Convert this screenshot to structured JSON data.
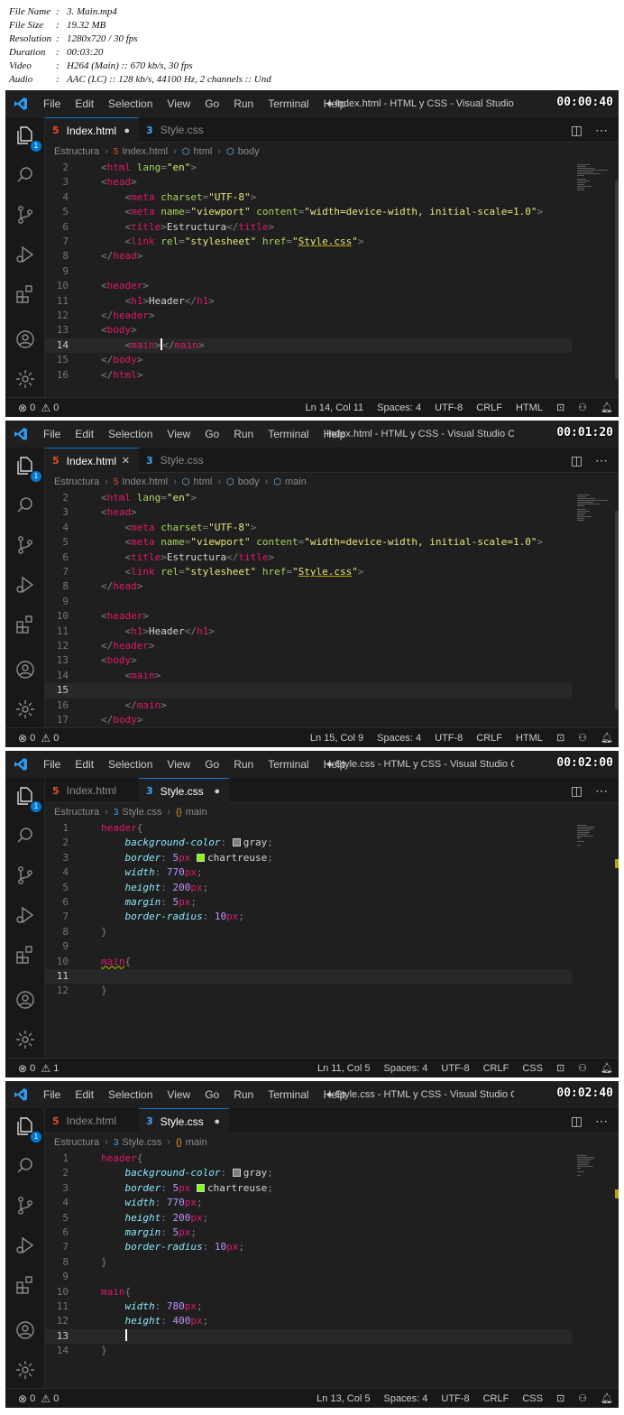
{
  "file_info": [
    {
      "key": "File Name",
      "value": "3. Main.mp4"
    },
    {
      "key": "File Size",
      "value": "19.32 MB"
    },
    {
      "key": "Resolution",
      "value": "1280x720 / 30 fps"
    },
    {
      "key": "Duration",
      "value": "00:03:20"
    },
    {
      "key": "Video",
      "value": "H264 (Main) :: 670 kb/s, 30 fps"
    },
    {
      "key": "Audio",
      "value": "AAC (LC) :: 128 kb/s, 44100 Hz, 2 channels :: Und"
    }
  ],
  "menu": [
    "File",
    "Edit",
    "Selection",
    "View",
    "Go",
    "Run",
    "Terminal",
    "Help"
  ],
  "colors": {
    "editor_bg": "#1f1f1f",
    "accent": "#0078d4",
    "tag": "#e0186c",
    "attribute": "#a9d45e",
    "string": "#e8e67d",
    "css_property": "#8be9fd",
    "number": "#bd93f9",
    "swatch_gray": "#808080",
    "swatch_chartreuse": "#7fff00"
  },
  "frames": [
    {
      "timestamp": "00:00:40",
      "window_title": "● Index.html - HTML y CSS - Visual Studio ...",
      "tabs": [
        {
          "label": "Index.html",
          "icon": "html-file-icon",
          "active": true,
          "mark": "●"
        },
        {
          "label": "Style.css",
          "icon": "css-file-icon",
          "active": false,
          "mark": ""
        }
      ],
      "breadcrumb": [
        "Estructura",
        "Index.html",
        "html",
        "body"
      ],
      "line_numbers": [
        "2",
        "3",
        "4",
        "5",
        "6",
        "7",
        "8",
        "9",
        "10",
        "11",
        "12",
        "13",
        "14",
        "15",
        "16"
      ],
      "current_line": "14",
      "problems": {
        "errors": "0",
        "warnings": "0"
      },
      "status": {
        "position": "Ln 14, Col 11",
        "spaces": "Spaces: 4",
        "encoding": "UTF-8",
        "eol": "CRLF",
        "language": "HTML"
      }
    },
    {
      "timestamp": "00:01:20",
      "window_title": "Index.html - HTML y CSS - Visual Studio C...",
      "tabs": [
        {
          "label": "Index.html",
          "icon": "html-file-icon",
          "active": true,
          "mark": "✕"
        },
        {
          "label": "Style.css",
          "icon": "css-file-icon",
          "active": false,
          "mark": ""
        }
      ],
      "breadcrumb": [
        "Estructura",
        "Index.html",
        "html",
        "body",
        "main"
      ],
      "line_numbers": [
        "2",
        "3",
        "4",
        "5",
        "6",
        "7",
        "8",
        "9",
        "10",
        "11",
        "12",
        "13",
        "14",
        "15",
        "16",
        "17"
      ],
      "current_line": "15",
      "problems": {
        "errors": "0",
        "warnings": "0"
      },
      "status": {
        "position": "Ln 15, Col 9",
        "spaces": "Spaces: 4",
        "encoding": "UTF-8",
        "eol": "CRLF",
        "language": "HTML"
      }
    },
    {
      "timestamp": "00:02:00",
      "window_title": "● Style.css - HTML y CSS - Visual Studio C...",
      "tabs": [
        {
          "label": "Index.html",
          "icon": "html-file-icon",
          "active": false,
          "mark": ""
        },
        {
          "label": "Style.css",
          "icon": "css-file-icon",
          "active": true,
          "mark": "●"
        }
      ],
      "breadcrumb": [
        "Estructura",
        "Style.css",
        "main"
      ],
      "line_numbers": [
        "1",
        "2",
        "3",
        "4",
        "5",
        "6",
        "7",
        "8",
        "9",
        "10",
        "11",
        "12"
      ],
      "current_line": "11",
      "problems": {
        "errors": "0",
        "warnings": "1"
      },
      "status": {
        "position": "Ln 11, Col 5",
        "spaces": "Spaces: 4",
        "encoding": "UTF-8",
        "eol": "CRLF",
        "language": "CSS"
      }
    },
    {
      "timestamp": "00:02:40",
      "window_title": "● Style.css - HTML y CSS - Visual Studio C...",
      "tabs": [
        {
          "label": "Index.html",
          "icon": "html-file-icon",
          "active": false,
          "mark": ""
        },
        {
          "label": "Style.css",
          "icon": "css-file-icon",
          "active": true,
          "mark": "●"
        }
      ],
      "breadcrumb": [
        "Estructura",
        "Style.css",
        "main"
      ],
      "line_numbers": [
        "1",
        "2",
        "3",
        "4",
        "5",
        "6",
        "7",
        "8",
        "9",
        "10",
        "11",
        "12",
        "13",
        "14"
      ],
      "current_line": "13",
      "problems": {
        "errors": "0",
        "warnings": "0"
      },
      "status": {
        "position": "Ln 13, Col 5",
        "spaces": "Spaces: 4",
        "encoding": "UTF-8",
        "eol": "CRLF",
        "language": "CSS"
      }
    }
  ],
  "code": {
    "html_lang": "\"en\"",
    "charset": "\"UTF-8\"",
    "viewport": "\"viewport\"",
    "content": "\"width=device-width, initial-scale=1.0\"",
    "title_text": "Estructura",
    "stylesheet": "\"stylesheet\"",
    "href": "Style.css",
    "h1_text": "Header",
    "css_bg_value": "gray",
    "css_border_value": "chartreuse",
    "css_width_1": "770",
    "css_height_1": "200",
    "css_margin": "5",
    "css_border_width": "5",
    "css_radius": "10",
    "css_width_2": "780",
    "css_height_2": "400"
  }
}
